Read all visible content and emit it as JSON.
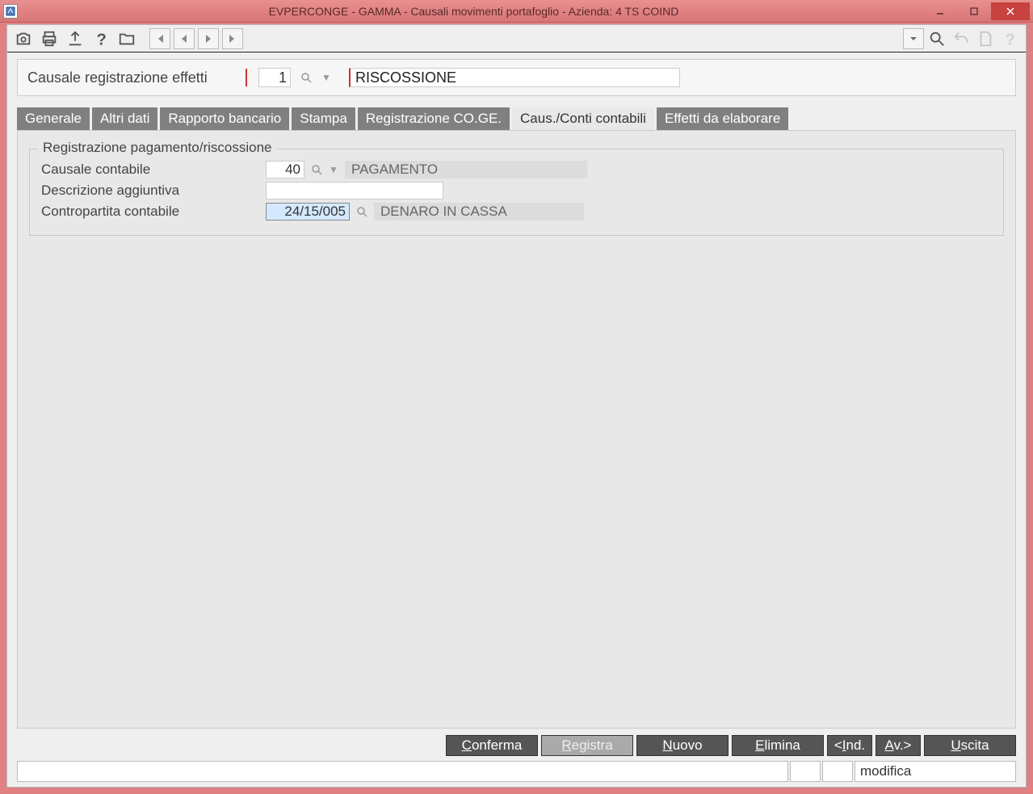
{
  "window": {
    "title": "EVPERCONGE - GAMMA - Causali movimenti portafoglio - Azienda:   4 TS COIND"
  },
  "header": {
    "label": "Causale registrazione effetti",
    "code": "1",
    "description": "RISCOSSIONE"
  },
  "tabs": [
    {
      "label": "Generale"
    },
    {
      "label": "Altri dati"
    },
    {
      "label": "Rapporto bancario"
    },
    {
      "label": "Stampa"
    },
    {
      "label": "Registrazione CO.GE."
    },
    {
      "label": "Caus./Conti contabili",
      "active": true
    },
    {
      "label": "Effetti da elaborare"
    }
  ],
  "fieldset": {
    "legend": "Registrazione pagamento/riscossione",
    "rows": {
      "causale": {
        "label": "Causale contabile",
        "code": "40",
        "desc": "PAGAMENTO"
      },
      "descrizione": {
        "label": "Descrizione aggiuntiva",
        "value": ""
      },
      "contropartita": {
        "label": "Contropartita contabile",
        "code": "24/15/005",
        "desc": "DENARO IN CASSA"
      }
    }
  },
  "actions": {
    "conferma": "Conferma",
    "registra": "Registra",
    "nuovo": "Nuovo",
    "elimina": "Elimina",
    "ind": "<Ind.",
    "av": "Av.>",
    "uscita": "Uscita"
  },
  "status": {
    "mode": "modifica"
  }
}
